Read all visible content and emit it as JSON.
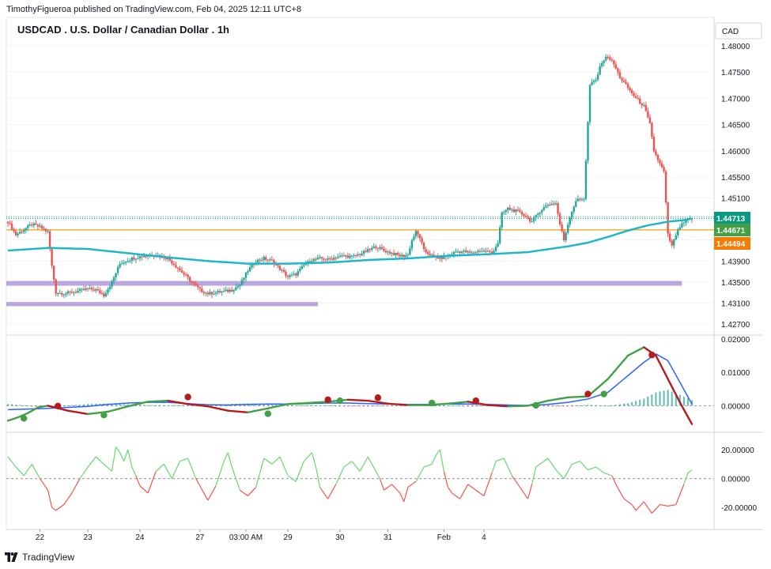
{
  "header": {
    "publisher_line": "TimothyFigueroa published on TradingView.com, Feb 04, 2025 12:11 UTC+8",
    "symbol_title": "USDCAD . U.S. Dollar / Canadian Dollar . 1h",
    "currency": "CAD"
  },
  "footer": {
    "brand": "TradingView"
  },
  "colors": {
    "up": "#26a69a",
    "down": "#ef5350",
    "ma": "#1fb7c8",
    "zone": "#b39ddb",
    "orange_line": "#f0a30a",
    "macd_blue": "#2962ff",
    "macd_green": "#43a047",
    "macd_red": "#b71c1c",
    "osc_green": "#4caf50",
    "osc_red": "#f44336"
  },
  "chart_data": [
    {
      "type": "candlestick",
      "title": "USDCAD . U.S. Dollar / Canadian Dollar . 1h",
      "y_ticks": [
        "1.48000",
        "1.47500",
        "1.47000",
        "1.46500",
        "1.46000",
        "1.45500",
        "1.45100",
        "1.44700",
        "1.44300",
        "1.43900",
        "1.43500",
        "1.43100",
        "1.42700"
      ],
      "ylim": [
        1.4255,
        1.4815
      ],
      "x_ticks": [
        "22",
        "23",
        "24",
        "27",
        "03:00 AM",
        "29",
        "30",
        "31",
        "Feb",
        "4"
      ],
      "price_labels": [
        {
          "value": "1.44713",
          "bg": "#089981"
        },
        {
          "value": "1.44671",
          "bg": "#43a047"
        },
        {
          "value": "1.44494",
          "bg": "#f57c00"
        }
      ],
      "horizontal_levels": [
        1.44713,
        1.44494
      ],
      "zones": [
        {
          "y_range": [
            1.4343,
            1.4352
          ],
          "x_range": [
            "Jan 21",
            "Feb 4"
          ]
        },
        {
          "y_range": [
            1.4304,
            1.4312
          ],
          "x_range": [
            "Jan 21",
            "Jan 29"
          ]
        }
      ],
      "price_path": [
        [
          0,
          1.4465
        ],
        [
          4,
          1.444
        ],
        [
          8,
          1.445
        ],
        [
          12,
          1.446
        ],
        [
          16,
          1.4455
        ],
        [
          20,
          1.4445
        ],
        [
          22,
          1.438
        ],
        [
          24,
          1.433
        ],
        [
          28,
          1.4328
        ],
        [
          34,
          1.4332
        ],
        [
          40,
          1.4337
        ],
        [
          44,
          1.4335
        ],
        [
          48,
          1.4325
        ],
        [
          52,
          1.435
        ],
        [
          56,
          1.4385
        ],
        [
          62,
          1.4395
        ],
        [
          68,
          1.44
        ],
        [
          74,
          1.4402
        ],
        [
          80,
          1.4395
        ],
        [
          84,
          1.438
        ],
        [
          88,
          1.4365
        ],
        [
          92,
          1.435
        ],
        [
          96,
          1.4335
        ],
        [
          100,
          1.4328
        ],
        [
          104,
          1.433
        ],
        [
          108,
          1.4332
        ],
        [
          112,
          1.4335
        ],
        [
          116,
          1.4345
        ],
        [
          120,
          1.4372
        ],
        [
          124,
          1.439
        ],
        [
          128,
          1.4395
        ],
        [
          132,
          1.439
        ],
        [
          136,
          1.4375
        ],
        [
          140,
          1.436
        ],
        [
          144,
          1.4365
        ],
        [
          148,
          1.4382
        ],
        [
          152,
          1.4392
        ],
        [
          156,
          1.4395
        ],
        [
          160,
          1.4393
        ],
        [
          164,
          1.4397
        ],
        [
          168,
          1.44
        ],
        [
          172,
          1.4398
        ],
        [
          176,
          1.4403
        ],
        [
          180,
          1.441
        ],
        [
          184,
          1.4418
        ],
        [
          188,
          1.441
        ],
        [
          192,
          1.4405
        ],
        [
          196,
          1.44
        ],
        [
          198,
          1.44
        ],
        [
          200,
          1.4402
        ],
        [
          202,
          1.443
        ],
        [
          204,
          1.4445
        ],
        [
          206,
          1.4435
        ],
        [
          208,
          1.441
        ],
        [
          212,
          1.44
        ],
        [
          216,
          1.4395
        ],
        [
          220,
          1.44
        ],
        [
          224,
          1.4408
        ],
        [
          228,
          1.4408
        ],
        [
          232,
          1.4405
        ],
        [
          236,
          1.441
        ],
        [
          240,
          1.4408
        ],
        [
          242,
          1.4405
        ],
        [
          245,
          1.4425
        ],
        [
          247,
          1.448
        ],
        [
          250,
          1.449
        ],
        [
          254,
          1.4485
        ],
        [
          258,
          1.4478
        ],
        [
          262,
          1.4465
        ],
        [
          266,
          1.4485
        ],
        [
          270,
          1.4498
        ],
        [
          274,
          1.45
        ],
        [
          276,
          1.446
        ],
        [
          278,
          1.443
        ],
        [
          281,
          1.4475
        ],
        [
          284,
          1.4505
        ],
        [
          288,
          1.451
        ],
        [
          291,
          1.4725
        ],
        [
          294,
          1.4735
        ],
        [
          297,
          1.477
        ],
        [
          300,
          1.478
        ],
        [
          303,
          1.4765
        ],
        [
          306,
          1.474
        ],
        [
          310,
          1.472
        ],
        [
          314,
          1.47
        ],
        [
          318,
          1.4685
        ],
        [
          321,
          1.465
        ],
        [
          323,
          1.46
        ],
        [
          326,
          1.4575
        ],
        [
          328,
          1.456
        ],
        [
          330,
          1.444
        ],
        [
          332,
          1.4418
        ],
        [
          334,
          1.444
        ],
        [
          336,
          1.4455
        ],
        [
          338,
          1.4463
        ],
        [
          340,
          1.4468
        ],
        [
          342,
          1.4471
        ]
      ],
      "ma_path": [
        [
          0,
          1.441
        ],
        [
          20,
          1.4415
        ],
        [
          40,
          1.4413
        ],
        [
          60,
          1.4405
        ],
        [
          80,
          1.4397
        ],
        [
          100,
          1.439
        ],
        [
          120,
          1.4385
        ],
        [
          140,
          1.4385
        ],
        [
          160,
          1.4387
        ],
        [
          180,
          1.4392
        ],
        [
          200,
          1.4395
        ],
        [
          220,
          1.44
        ],
        [
          240,
          1.4403
        ],
        [
          260,
          1.4407
        ],
        [
          280,
          1.4418
        ],
        [
          290,
          1.4425
        ],
        [
          300,
          1.4436
        ],
        [
          310,
          1.4448
        ],
        [
          320,
          1.4458
        ],
        [
          330,
          1.4465
        ],
        [
          338,
          1.4468
        ],
        [
          342,
          1.4471
        ]
      ]
    },
    {
      "type": "line",
      "name": "macd-panel",
      "y_ticks": [
        "0.02000",
        "0.01000",
        "0.00000"
      ],
      "ylim": [
        -0.0063,
        0.0202
      ],
      "series_blue": [
        [
          0,
          -0.0012
        ],
        [
          10,
          -0.001
        ],
        [
          20,
          -0.0008
        ],
        [
          30,
          -0.0005
        ],
        [
          40,
          -0.0002
        ],
        [
          50,
          0.0004
        ],
        [
          60,
          0.0008
        ],
        [
          70,
          0.001
        ],
        [
          80,
          0.001
        ],
        [
          90,
          0.0006
        ],
        [
          100,
          0.0003
        ],
        [
          110,
          0.0002
        ],
        [
          120,
          0.0004
        ],
        [
          130,
          0.0005
        ],
        [
          140,
          0.0005
        ],
        [
          150,
          0.0006
        ],
        [
          160,
          0.0008
        ],
        [
          170,
          0.0008
        ],
        [
          180,
          0.0006
        ],
        [
          190,
          0.0005
        ],
        [
          200,
          0.0004
        ],
        [
          210,
          0.0004
        ],
        [
          220,
          0.0005
        ],
        [
          230,
          0.0005
        ],
        [
          240,
          0.0004
        ],
        [
          250,
          0.0002
        ],
        [
          260,
          0.0001
        ],
        [
          270,
          0.0004
        ],
        [
          280,
          0.001
        ],
        [
          290,
          0.002
        ],
        [
          300,
          0.004
        ],
        [
          310,
          0.009
        ],
        [
          318,
          0.013
        ],
        [
          324,
          0.0155
        ],
        [
          330,
          0.0135
        ],
        [
          336,
          0.007
        ],
        [
          342,
          0.0005
        ]
      ],
      "series_signal": [
        [
          0,
          -0.0045
        ],
        [
          5,
          -0.0035
        ],
        [
          10,
          -0.0022
        ],
        [
          15,
          -0.0005
        ],
        [
          20,
          0.0
        ],
        [
          30,
          -0.0015
        ],
        [
          40,
          -0.0025
        ],
        [
          50,
          -0.0018
        ],
        [
          60,
          -0.0002
        ],
        [
          70,
          0.0012
        ],
        [
          80,
          0.0015
        ],
        [
          90,
          0.0005
        ],
        [
          100,
          -0.0002
        ],
        [
          110,
          -0.0015
        ],
        [
          120,
          -0.002
        ],
        [
          130,
          -0.0008
        ],
        [
          140,
          0.0005
        ],
        [
          150,
          0.0008
        ],
        [
          160,
          0.0012
        ],
        [
          170,
          0.0018
        ],
        [
          180,
          0.0015
        ],
        [
          190,
          0.0006
        ],
        [
          200,
          0.0002
        ],
        [
          210,
          0.0002
        ],
        [
          220,
          0.0006
        ],
        [
          230,
          0.0012
        ],
        [
          240,
          0.0002
        ],
        [
          250,
          -0.0002
        ],
        [
          260,
          0.0
        ],
        [
          270,
          0.0015
        ],
        [
          280,
          0.0025
        ],
        [
          290,
          0.0028
        ],
        [
          300,
          0.008
        ],
        [
          310,
          0.015
        ],
        [
          318,
          0.0175
        ],
        [
          324,
          0.015
        ],
        [
          330,
          0.008
        ],
        [
          336,
          0.001
        ],
        [
          342,
          -0.0055
        ]
      ],
      "cross_points": [
        {
          "x": 8,
          "y": -0.0038,
          "kind": "bull"
        },
        {
          "x": 25,
          "y": -0.0001,
          "kind": "bear"
        },
        {
          "x": 48,
          "y": -0.0028,
          "kind": "bull"
        },
        {
          "x": 90,
          "y": 0.0026,
          "kind": "bear"
        },
        {
          "x": 130,
          "y": -0.0024,
          "kind": "bull"
        },
        {
          "x": 160,
          "y": 0.0018,
          "kind": "bear"
        },
        {
          "x": 166,
          "y": 0.0015,
          "kind": "bull"
        },
        {
          "x": 185,
          "y": 0.0024,
          "kind": "bear"
        },
        {
          "x": 212,
          "y": 0.0008,
          "kind": "bull"
        },
        {
          "x": 234,
          "y": 0.0015,
          "kind": "bear"
        },
        {
          "x": 264,
          "y": 0.0001,
          "kind": "bull"
        },
        {
          "x": 290,
          "y": 0.0035,
          "kind": "bear"
        },
        {
          "x": 298,
          "y": 0.0035,
          "kind": "bull"
        },
        {
          "x": 322,
          "y": 0.0152,
          "kind": "bear"
        }
      ]
    },
    {
      "type": "line",
      "name": "oscillator-panel",
      "y_ticks": [
        "20.00000",
        "0.00000",
        "-20.00000"
      ],
      "ylim": [
        -27,
        26
      ],
      "series": [
        [
          0,
          15
        ],
        [
          4,
          8
        ],
        [
          8,
          2
        ],
        [
          12,
          10
        ],
        [
          16,
          0
        ],
        [
          20,
          -8
        ],
        [
          22,
          -20
        ],
        [
          24,
          -22
        ],
        [
          28,
          -18
        ],
        [
          32,
          -10
        ],
        [
          36,
          0
        ],
        [
          40,
          8
        ],
        [
          44,
          15
        ],
        [
          48,
          10
        ],
        [
          52,
          5
        ],
        [
          54,
          22
        ],
        [
          56,
          18
        ],
        [
          58,
          12
        ],
        [
          60,
          20
        ],
        [
          62,
          8
        ],
        [
          64,
          2
        ],
        [
          66,
          -5
        ],
        [
          70,
          -10
        ],
        [
          74,
          5
        ],
        [
          78,
          10
        ],
        [
          82,
          0
        ],
        [
          86,
          12
        ],
        [
          90,
          14
        ],
        [
          94,
          0
        ],
        [
          96,
          -5
        ],
        [
          100,
          -15
        ],
        [
          104,
          -5
        ],
        [
          108,
          12
        ],
        [
          110,
          18
        ],
        [
          112,
          8
        ],
        [
          116,
          -8
        ],
        [
          120,
          -12
        ],
        [
          124,
          -6
        ],
        [
          128,
          14
        ],
        [
          132,
          10
        ],
        [
          136,
          15
        ],
        [
          140,
          2
        ],
        [
          144,
          -2
        ],
        [
          148,
          12
        ],
        [
          152,
          18
        ],
        [
          154,
          8
        ],
        [
          156,
          -6
        ],
        [
          160,
          -14
        ],
        [
          164,
          -4
        ],
        [
          168,
          8
        ],
        [
          172,
          12
        ],
        [
          176,
          5
        ],
        [
          180,
          15
        ],
        [
          182,
          10
        ],
        [
          186,
          0
        ],
        [
          188,
          -8
        ],
        [
          192,
          -4
        ],
        [
          196,
          -10
        ],
        [
          198,
          -16
        ],
        [
          200,
          -6
        ],
        [
          204,
          -2
        ],
        [
          208,
          8
        ],
        [
          212,
          10
        ],
        [
          214,
          16
        ],
        [
          216,
          20
        ],
        [
          218,
          5
        ],
        [
          220,
          -6
        ],
        [
          222,
          -10
        ],
        [
          226,
          -14
        ],
        [
          230,
          -4
        ],
        [
          234,
          -8
        ],
        [
          238,
          -12
        ],
        [
          242,
          4
        ],
        [
          244,
          12
        ],
        [
          248,
          14
        ],
        [
          252,
          2
        ],
        [
          256,
          -6
        ],
        [
          260,
          -14
        ],
        [
          262,
          -4
        ],
        [
          264,
          8
        ],
        [
          268,
          12
        ],
        [
          270,
          14
        ],
        [
          274,
          6
        ],
        [
          278,
          0
        ],
        [
          282,
          10
        ],
        [
          286,
          12
        ],
        [
          290,
          6
        ],
        [
          294,
          8
        ],
        [
          298,
          4
        ],
        [
          302,
          2
        ],
        [
          304,
          -4
        ],
        [
          308,
          -14
        ],
        [
          312,
          -18
        ],
        [
          314,
          -22
        ],
        [
          318,
          -16
        ],
        [
          322,
          -24
        ],
        [
          326,
          -18
        ],
        [
          330,
          -19
        ],
        [
          334,
          -18
        ],
        [
          338,
          -4
        ],
        [
          340,
          4
        ],
        [
          342,
          6
        ]
      ],
      "zero_level": 0
    }
  ]
}
